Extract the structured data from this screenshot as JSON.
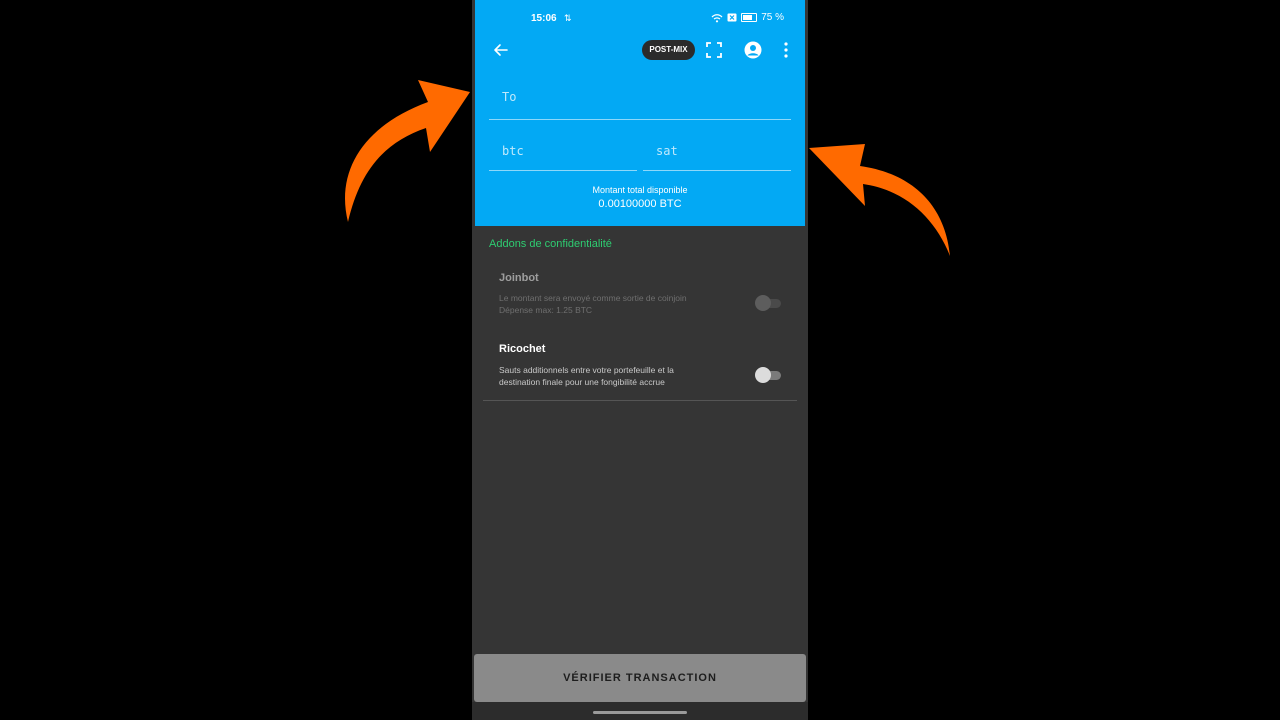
{
  "status_bar": {
    "time": "15:06",
    "battery_percent": "75 %",
    "battery_level": 0.75
  },
  "app_bar": {
    "badge": "POST-MIX"
  },
  "form": {
    "to_placeholder": "To",
    "btc_placeholder": "btc",
    "sat_placeholder": "sat",
    "balance_label": "Montant total disponible",
    "balance_value": "0.00100000 BTC"
  },
  "addons": {
    "section_title": "Addons de confidentialité",
    "joinbot": {
      "title": "Joinbot",
      "description": "Le montant sera envoyé comme sortie de coinjoin\nDépense max: 1.25 BTC",
      "enabled": false
    },
    "ricochet": {
      "title": "Ricochet",
      "description": "Sauts additionnels entre votre portefeuille et la\ndestination finale pour une fongibilité accrue",
      "enabled": false
    }
  },
  "footer": {
    "verify_button": "VÉRIFIER TRANSACTION"
  },
  "colors": {
    "header": "#03a9f4",
    "accent_green": "#2ecc71",
    "arrow_orange": "#ff6a00",
    "background": "#353535"
  },
  "icons": [
    "back-arrow-icon",
    "scan-icon",
    "account-icon",
    "more-vert-icon",
    "wifi-icon",
    "battery-icon"
  ]
}
